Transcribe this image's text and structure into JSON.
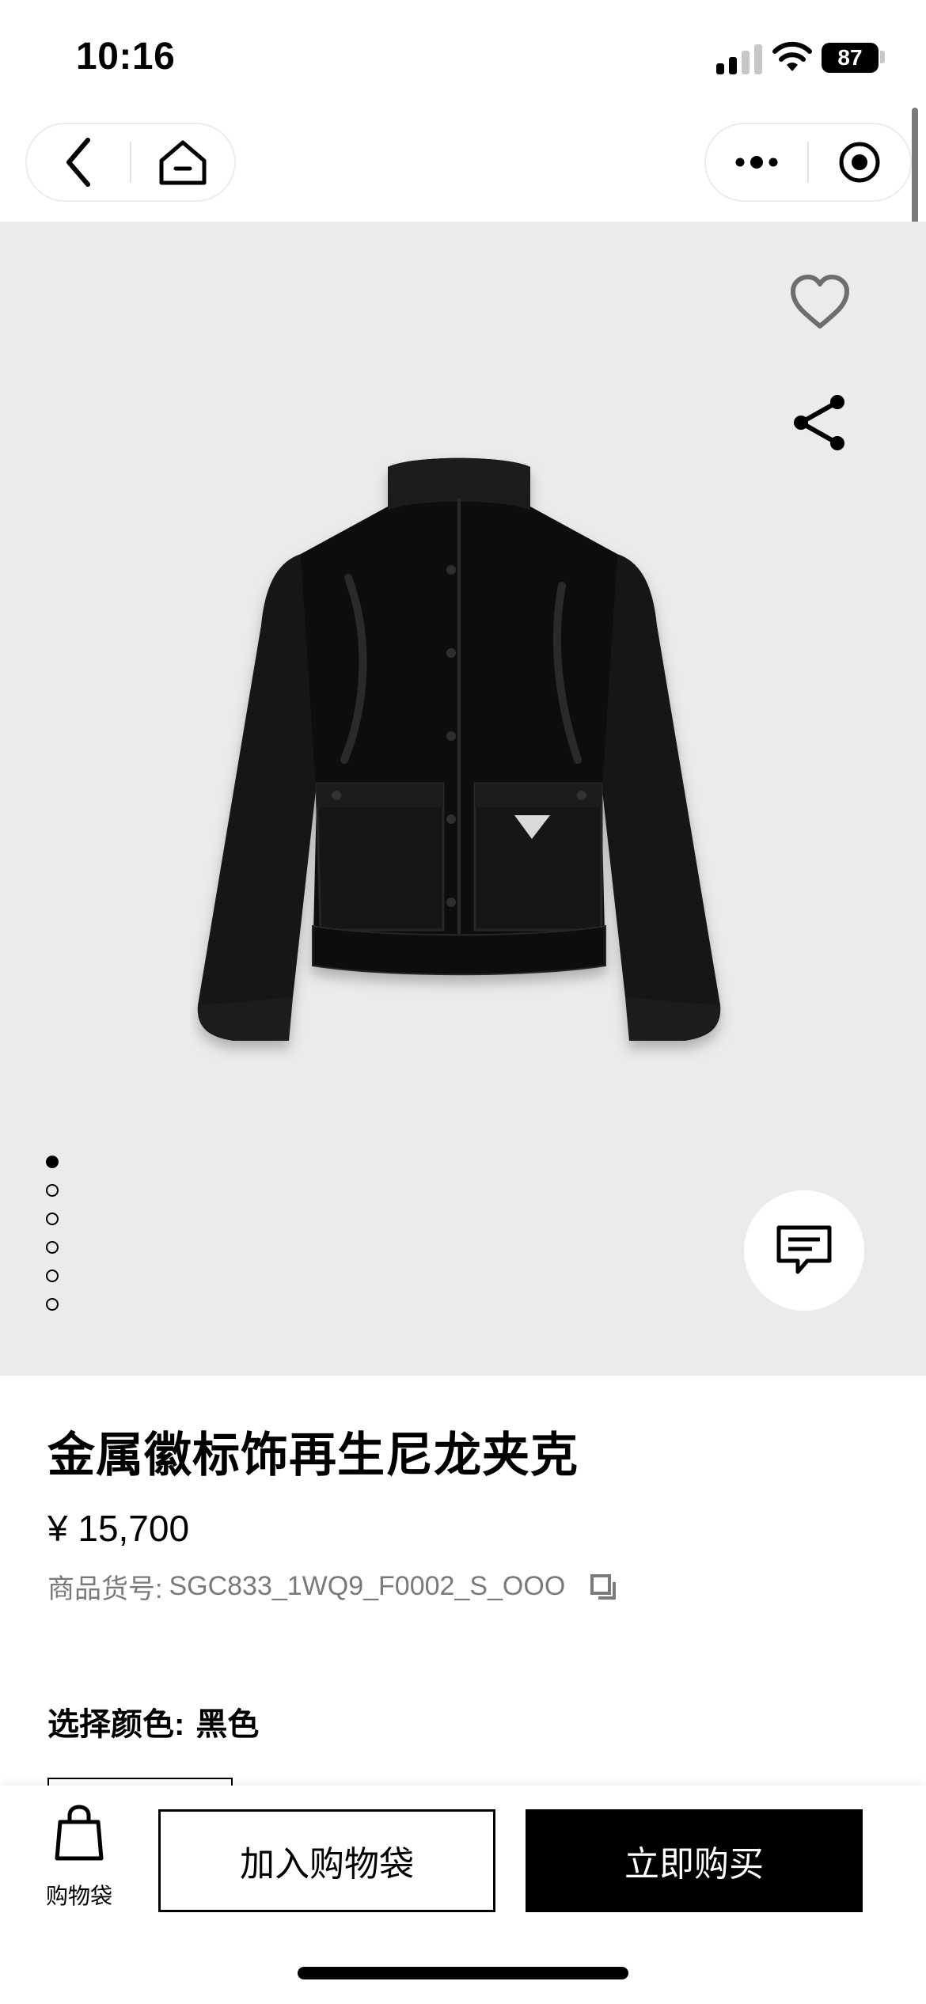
{
  "status_bar": {
    "time": "10:16",
    "battery": "87"
  },
  "nav": {
    "back_icon": "chevron-left-icon",
    "home_icon": "home-icon",
    "more_icon": "more-dots-icon",
    "close_icon": "target-icon"
  },
  "hero": {
    "favorite_icon": "heart-outline-icon",
    "share_icon": "share-icon",
    "chat_icon": "chat-icon",
    "image_count": 6,
    "active_image": 1
  },
  "product": {
    "title": "金属徽标饰再生尼龙夹克",
    "price": "¥ 15,700",
    "sku_label": "商品货号:",
    "sku_value": "SGC833_1WQ9_F0002_S_OOO",
    "color_label": "选择颜色:",
    "color_value": "黑色"
  },
  "bottom_bar": {
    "bag_label": "购物袋",
    "add_to_bag": "加入购物袋",
    "buy_now": "立即购买"
  },
  "colors": {
    "hero_background": "#ebebeb",
    "primary": "#000000",
    "muted_text": "#7a7a7a"
  }
}
